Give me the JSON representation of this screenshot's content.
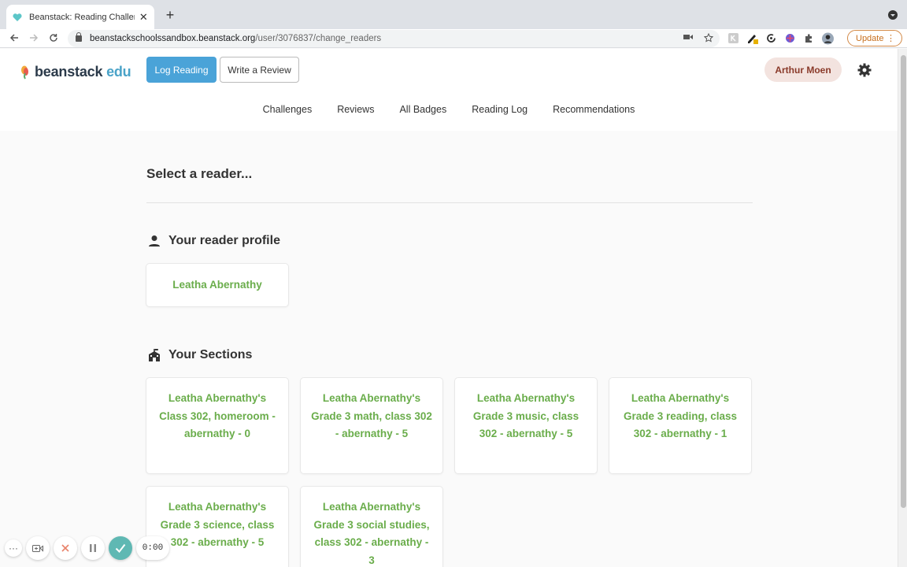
{
  "browser": {
    "tab_title": "Beanstack: Reading Challenge",
    "tab_close": "✕",
    "new_tab": "+",
    "url_host": "beanstackschoolssandbox.beanstack.org",
    "url_path": "/user/3076837/change_readers",
    "update_label": "Update",
    "update_menu": "⋮"
  },
  "header": {
    "logo_main": "beanstack",
    "logo_suffix": "edu",
    "log_reading_label": "Log Reading",
    "write_review_label": "Write a Review",
    "user_name": "Arthur Moen"
  },
  "nav": {
    "items": [
      "Challenges",
      "Reviews",
      "All Badges",
      "Reading Log",
      "Recommendations"
    ]
  },
  "page": {
    "title": "Select a reader...",
    "profile_heading": "Your reader profile",
    "profile_name": "Leatha Abernathy",
    "sections_heading": "Your Sections",
    "sections": [
      "Leatha Abernathy's Class 302, homeroom - abernathy - 0",
      "Leatha Abernathy's Grade 3 math, class 302 - abernathy - 5",
      "Leatha Abernathy's Grade 3 music, class 302 - abernathy - 5",
      "Leatha Abernathy's Grade 3 reading, class 302 - abernathy - 1",
      "Leatha Abernathy's Grade 3 science, class 302 - abernathy - 5",
      "Leatha Abernathy's Grade 3 social studies, class 302 - abernathy - 3"
    ]
  },
  "recorder": {
    "more": "···",
    "time": "0:00"
  },
  "colors": {
    "accent_blue": "#4aa3d8",
    "link_green": "#6aad4b",
    "user_pill": "#f3e3df",
    "recorder_check": "#5fb8b3"
  }
}
